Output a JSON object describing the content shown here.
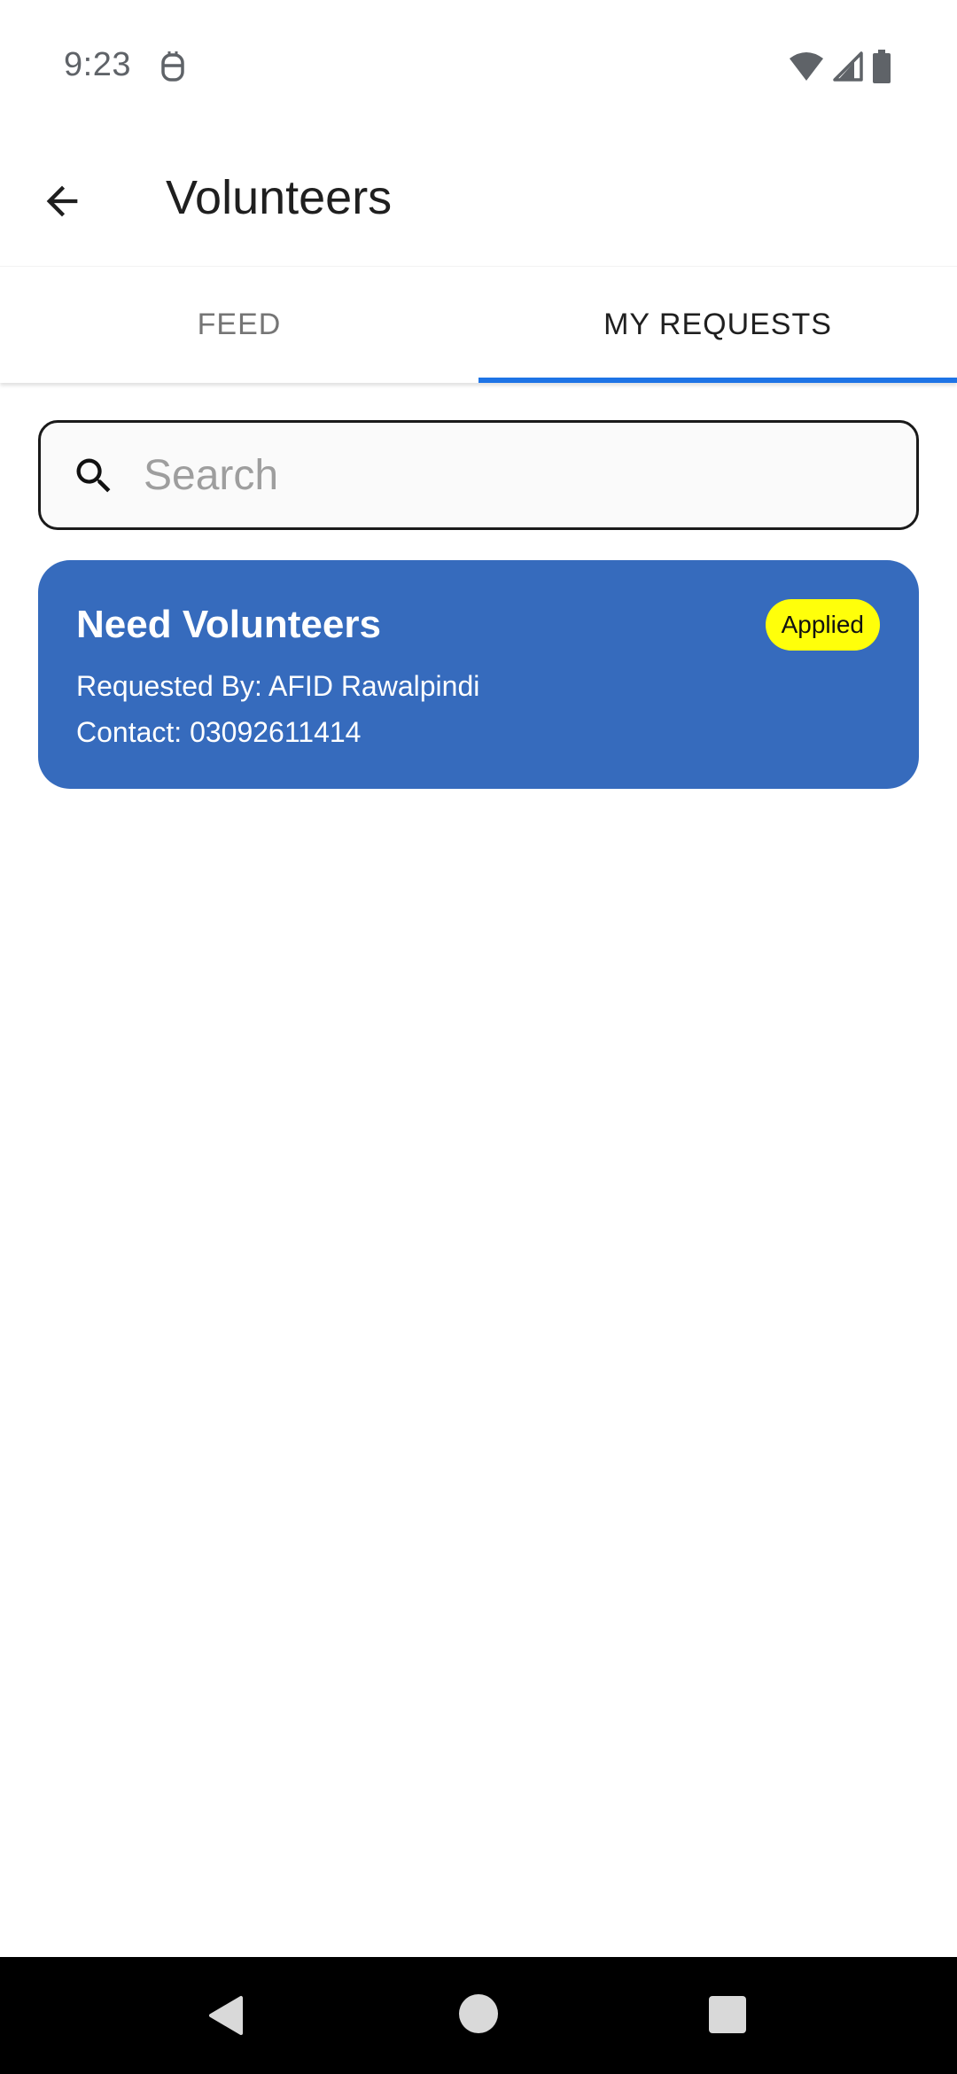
{
  "status_bar": {
    "time": "9:23",
    "notification_icon": "robot-icon",
    "wifi_icon": "wifi-icon",
    "signal_icon": "signal-icon",
    "battery_icon": "battery-icon"
  },
  "app_bar": {
    "back_icon": "arrow-back-icon",
    "title": "Volunteers"
  },
  "tabs": [
    {
      "label": "FEED",
      "active": false
    },
    {
      "label": "MY REQUESTS",
      "active": true
    }
  ],
  "search": {
    "placeholder": "Search",
    "value": "",
    "icon": "search-icon"
  },
  "requests": [
    {
      "title": "Need Volunteers",
      "requested_by": "Requested By: AFID Rawalpindi",
      "contact": "Contact: 03092611414",
      "status": "Applied"
    }
  ],
  "colors": {
    "accent": "#1e74e6",
    "card": "#366bbd",
    "badge": "#ffff0a"
  },
  "nav_bar": {
    "back_icon": "nav-back-icon",
    "home_icon": "nav-home-icon",
    "recents_icon": "nav-recents-icon"
  }
}
